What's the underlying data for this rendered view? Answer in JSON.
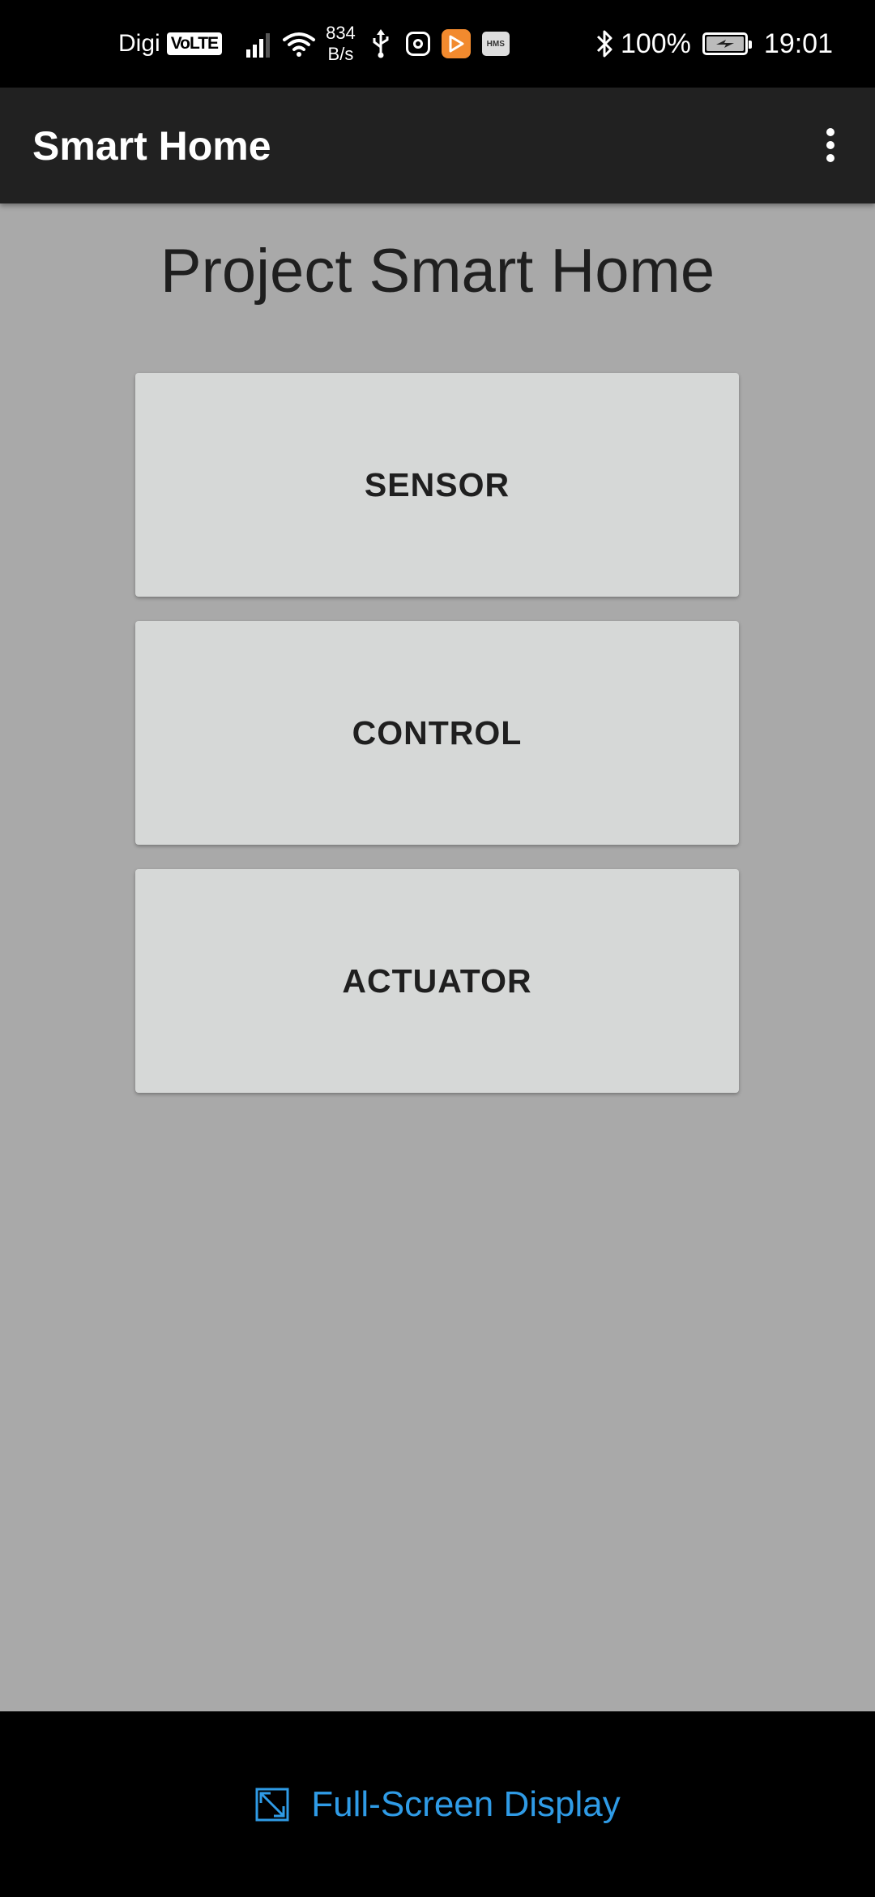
{
  "status_bar": {
    "carrier": "Digi",
    "volte": "VoLTE",
    "net_speed_value": "834",
    "net_speed_unit": "B/s",
    "hms": "HMS",
    "battery_percent": "100%",
    "time": "19:01"
  },
  "app_bar": {
    "title": "Smart Home"
  },
  "main": {
    "heading": "Project Smart Home",
    "buttons": {
      "sensor": "SENSOR",
      "control": "CONTROL",
      "actuator": "ACTUATOR"
    }
  },
  "bottom_bar": {
    "fullscreen_label": "Full-Screen Display"
  },
  "colors": {
    "app_bar_bg": "#212121",
    "content_bg": "#a9a9a9",
    "button_bg": "#d6d8d7",
    "link_blue": "#2f9be6",
    "play_orange": "#f28a2e"
  }
}
